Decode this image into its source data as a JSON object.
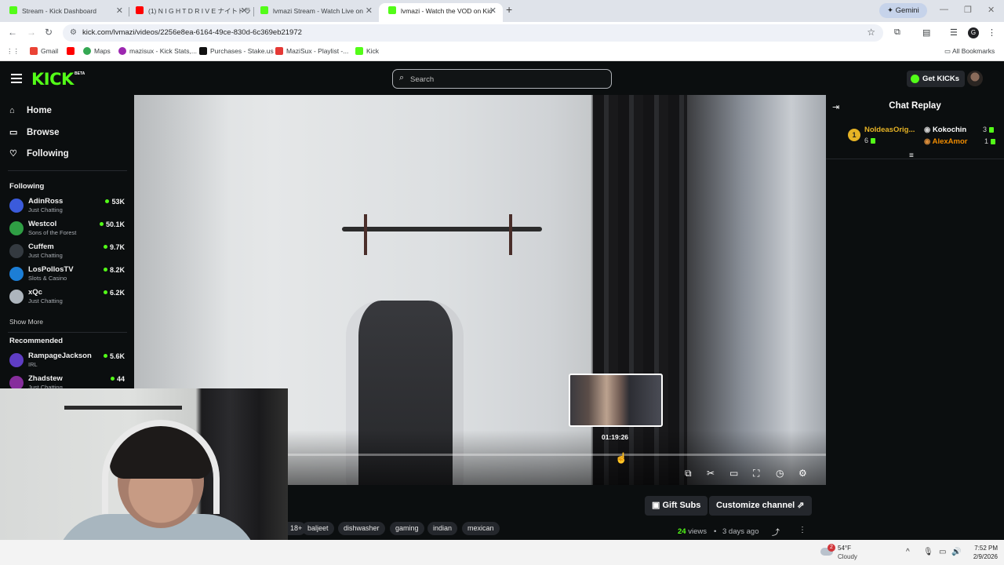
{
  "browser": {
    "tabs": [
      {
        "title": "Stream - Kick Dashboard",
        "favicon_color": "#53fc18",
        "active": false
      },
      {
        "title": "(1) N I G H T D R I V E ナイトドラ",
        "favicon_color": "#ff0000",
        "active": false
      },
      {
        "title": "lvmazi Stream - Watch Live on",
        "favicon_color": "#53fc18",
        "active": false
      },
      {
        "title": "lvmazi - Watch the VOD on Kic",
        "favicon_color": "#53fc18",
        "active": true
      }
    ],
    "new_tab_label": "+",
    "gemini_label": "Gemini",
    "url": "kick.com/lvmazi/videos/2256e8ea-6164-49ce-830d-6c369eb21972",
    "profile_initial": "G",
    "bookmarks": [
      {
        "label": "Gmail",
        "icon_color": "#ea4335"
      },
      {
        "label": "",
        "icon_color": "#ff0000"
      },
      {
        "label": "Maps",
        "icon_color": "#34a853"
      },
      {
        "label": "mazisux - Kick Stats,...",
        "icon_color": "#9c27b0"
      },
      {
        "label": "Purchases - Stake.us",
        "icon_color": "#111111"
      },
      {
        "label": "MaziSux - Playlist -...",
        "icon_color": "#e53935"
      },
      {
        "label": "Kick",
        "icon_color": "#53fc18"
      }
    ],
    "all_bookmarks": "All Bookmarks"
  },
  "kick": {
    "logo": "KICK",
    "beta": "BETA",
    "search_placeholder": "Search",
    "get_kicks": "Get KICKs",
    "nav": [
      {
        "label": "Home",
        "icon": "home-icon",
        "glyph": "⌂"
      },
      {
        "label": "Browse",
        "icon": "browse-icon",
        "glyph": "▭"
      },
      {
        "label": "Following",
        "icon": "heart-icon",
        "glyph": "♡"
      }
    ],
    "following_heading": "Following",
    "following": [
      {
        "name": "AdinRoss",
        "category": "Just Chatting",
        "viewers": "53K",
        "avatar": "#3b5bdb"
      },
      {
        "name": "Westcol",
        "category": "Sons of the Forest",
        "viewers": "50.1K",
        "avatar": "#2f9e44"
      },
      {
        "name": "Cuffem",
        "category": "Just Chatting",
        "viewers": "9.7K",
        "avatar": "#343a40"
      },
      {
        "name": "LosPollosTV",
        "category": "Slots & Casino",
        "viewers": "8.2K",
        "avatar": "#1c7ed6"
      },
      {
        "name": "xQc",
        "category": "Just Chatting",
        "viewers": "6.2K",
        "avatar": "#adb5bd"
      }
    ],
    "show_more": "Show More",
    "recommended_heading": "Recommended",
    "recommended": [
      {
        "name": "RampageJackson",
        "category": "IRL",
        "viewers": "5.6K",
        "avatar": "#5f3dc4"
      },
      {
        "name": "Zhadstew",
        "category": "Just Chatting",
        "viewers": "44",
        "avatar": "#862e9c"
      }
    ]
  },
  "player": {
    "hover_time": "01:19:26",
    "progress": 0.61,
    "controls": [
      {
        "name": "miniplayer-icon",
        "glyph": "⧉"
      },
      {
        "name": "clip-icon",
        "glyph": "✂"
      },
      {
        "name": "theater-mode-icon",
        "glyph": "▭"
      },
      {
        "name": "fullscreen-icon",
        "glyph": "⛶"
      },
      {
        "name": "playback-speed-icon",
        "glyph": "◷"
      },
      {
        "name": "settings-icon",
        "glyph": "⚙"
      }
    ]
  },
  "below": {
    "gift_subs": "Gift Subs",
    "customize_channel": "Customize channel",
    "tags": [
      "18+",
      "baljeet",
      "dishwasher",
      "gaming",
      "indian",
      "mexican"
    ],
    "views_count": "24",
    "views_label": "views",
    "ago": "3 days ago"
  },
  "chat": {
    "title": "Chat Replay",
    "gifters": [
      {
        "rank": "1",
        "name": "NoIdeasOrig...",
        "count": "6",
        "color": "#e6b325"
      },
      {
        "rank": "",
        "name": "Kokochin",
        "count": "3",
        "color": "#ffffff"
      },
      {
        "rank": "",
        "name": "AlexAmor",
        "count": "1",
        "color": "#f08c00"
      }
    ]
  },
  "taskbar": {
    "notification_count": "2",
    "temperature": "54°F",
    "weather": "Cloudy",
    "time": "7:52 PM",
    "date": "2/9/2026"
  }
}
